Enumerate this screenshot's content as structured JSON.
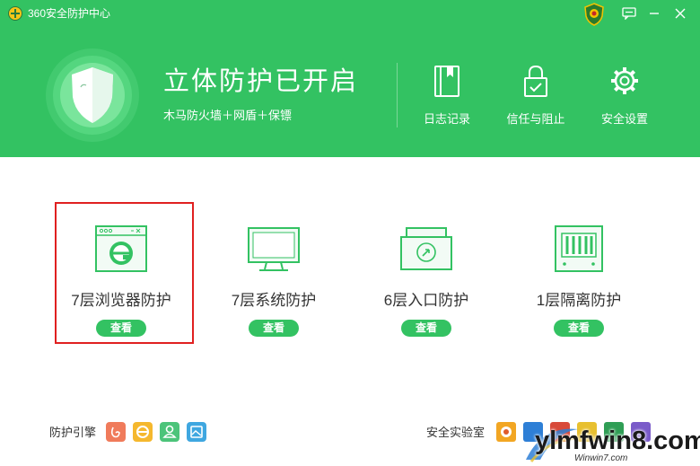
{
  "window": {
    "title": "360安全防护中心"
  },
  "status": {
    "title": "立体防护已开启",
    "subtitle": "木马防火墙＋网盾＋保镖"
  },
  "tools": [
    {
      "label": "日志记录",
      "icon": "log-book-icon"
    },
    {
      "label": "信任与阻止",
      "icon": "lock-icon"
    },
    {
      "label": "安全设置",
      "icon": "gear-icon"
    }
  ],
  "cards": [
    {
      "title": "7层浏览器防护",
      "button": "查看",
      "icon": "browser-icon",
      "selected": true
    },
    {
      "title": "7层系统防护",
      "button": "查看",
      "icon": "monitor-icon",
      "selected": false
    },
    {
      "title": "6层入口防护",
      "button": "查看",
      "icon": "entry-icon",
      "selected": false
    },
    {
      "title": "1层隔离防护",
      "button": "查看",
      "icon": "isolation-icon",
      "selected": false
    }
  ],
  "footer": {
    "engines_label": "防护引擎",
    "engines": [
      {
        "icon": "engine-red-icon",
        "color": "#f07b5b"
      },
      {
        "icon": "engine-browser-icon",
        "color": "#f5b82e"
      },
      {
        "icon": "engine-user-icon",
        "color": "#4cc47a"
      },
      {
        "icon": "engine-image-icon",
        "color": "#3fa7e0"
      }
    ],
    "lab_label": "安全实验室"
  },
  "watermark": {
    "main": "ylmfwin8.com",
    "small": "Winwin7.com"
  },
  "colors": {
    "brand_green": "#33c262",
    "highlight_red": "#e02020"
  }
}
